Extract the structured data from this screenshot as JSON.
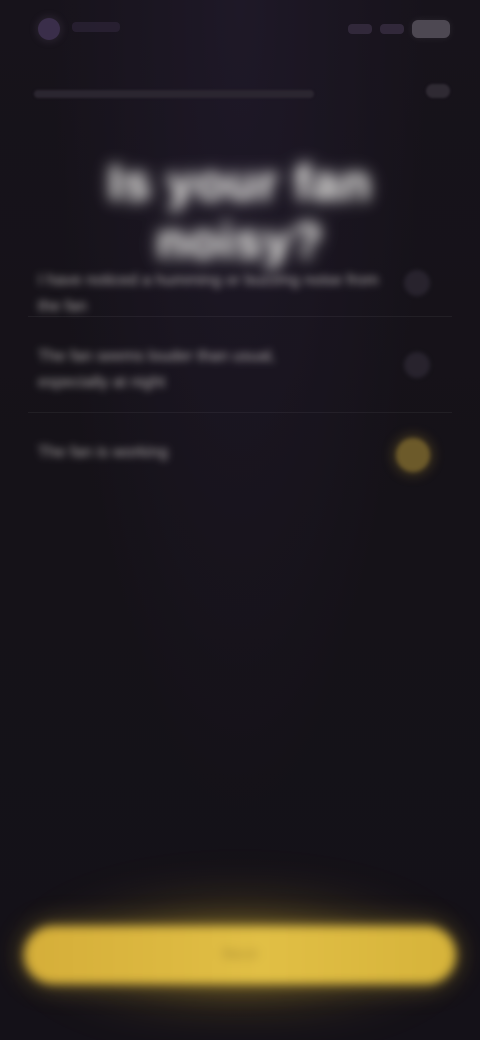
{
  "status_bar": {
    "app_icon": "app-icon",
    "battery_icon": "battery-icon"
  },
  "header": {
    "title": "Is your fan noisy?"
  },
  "questions": [
    {
      "text": "I have noticed a humming or buzzing noise from the fan",
      "state": "unselected"
    },
    {
      "text": "The fan seems louder than usual,\nespecially at night",
      "state": "unselected"
    },
    {
      "text": "The fan is working",
      "state": "selected"
    }
  ],
  "actions": {
    "primary_label": "Next"
  },
  "colors": {
    "background": "#15121a",
    "accent": "#e1bf45",
    "selected_indicator": "#6c5a2a"
  }
}
